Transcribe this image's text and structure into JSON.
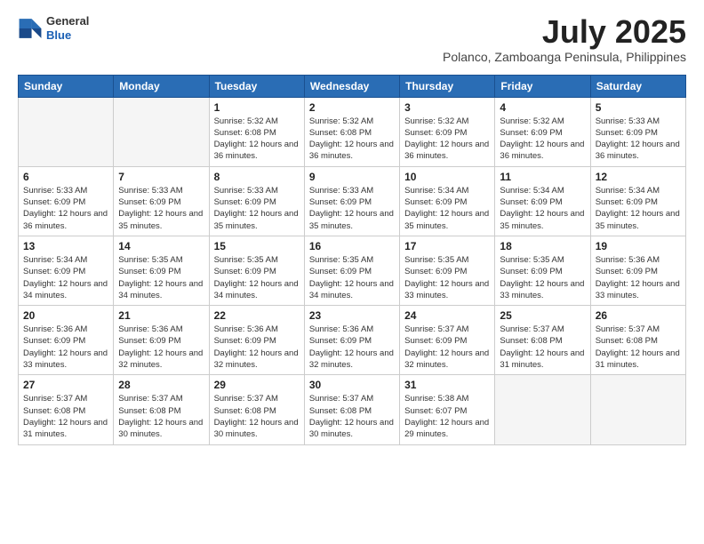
{
  "header": {
    "logo": {
      "general": "General",
      "blue": "Blue"
    },
    "title": "July 2025",
    "subtitle": "Polanco, Zamboanga Peninsula, Philippines"
  },
  "weekdays": [
    "Sunday",
    "Monday",
    "Tuesday",
    "Wednesday",
    "Thursday",
    "Friday",
    "Saturday"
  ],
  "weeks": [
    [
      {
        "day": "",
        "empty": true
      },
      {
        "day": "",
        "empty": true
      },
      {
        "day": "1",
        "sunrise": "Sunrise: 5:32 AM",
        "sunset": "Sunset: 6:08 PM",
        "daylight": "Daylight: 12 hours and 36 minutes."
      },
      {
        "day": "2",
        "sunrise": "Sunrise: 5:32 AM",
        "sunset": "Sunset: 6:08 PM",
        "daylight": "Daylight: 12 hours and 36 minutes."
      },
      {
        "day": "3",
        "sunrise": "Sunrise: 5:32 AM",
        "sunset": "Sunset: 6:09 PM",
        "daylight": "Daylight: 12 hours and 36 minutes."
      },
      {
        "day": "4",
        "sunrise": "Sunrise: 5:32 AM",
        "sunset": "Sunset: 6:09 PM",
        "daylight": "Daylight: 12 hours and 36 minutes."
      },
      {
        "day": "5",
        "sunrise": "Sunrise: 5:33 AM",
        "sunset": "Sunset: 6:09 PM",
        "daylight": "Daylight: 12 hours and 36 minutes."
      }
    ],
    [
      {
        "day": "6",
        "sunrise": "Sunrise: 5:33 AM",
        "sunset": "Sunset: 6:09 PM",
        "daylight": "Daylight: 12 hours and 36 minutes."
      },
      {
        "day": "7",
        "sunrise": "Sunrise: 5:33 AM",
        "sunset": "Sunset: 6:09 PM",
        "daylight": "Daylight: 12 hours and 35 minutes."
      },
      {
        "day": "8",
        "sunrise": "Sunrise: 5:33 AM",
        "sunset": "Sunset: 6:09 PM",
        "daylight": "Daylight: 12 hours and 35 minutes."
      },
      {
        "day": "9",
        "sunrise": "Sunrise: 5:33 AM",
        "sunset": "Sunset: 6:09 PM",
        "daylight": "Daylight: 12 hours and 35 minutes."
      },
      {
        "day": "10",
        "sunrise": "Sunrise: 5:34 AM",
        "sunset": "Sunset: 6:09 PM",
        "daylight": "Daylight: 12 hours and 35 minutes."
      },
      {
        "day": "11",
        "sunrise": "Sunrise: 5:34 AM",
        "sunset": "Sunset: 6:09 PM",
        "daylight": "Daylight: 12 hours and 35 minutes."
      },
      {
        "day": "12",
        "sunrise": "Sunrise: 5:34 AM",
        "sunset": "Sunset: 6:09 PM",
        "daylight": "Daylight: 12 hours and 35 minutes."
      }
    ],
    [
      {
        "day": "13",
        "sunrise": "Sunrise: 5:34 AM",
        "sunset": "Sunset: 6:09 PM",
        "daylight": "Daylight: 12 hours and 34 minutes."
      },
      {
        "day": "14",
        "sunrise": "Sunrise: 5:35 AM",
        "sunset": "Sunset: 6:09 PM",
        "daylight": "Daylight: 12 hours and 34 minutes."
      },
      {
        "day": "15",
        "sunrise": "Sunrise: 5:35 AM",
        "sunset": "Sunset: 6:09 PM",
        "daylight": "Daylight: 12 hours and 34 minutes."
      },
      {
        "day": "16",
        "sunrise": "Sunrise: 5:35 AM",
        "sunset": "Sunset: 6:09 PM",
        "daylight": "Daylight: 12 hours and 34 minutes."
      },
      {
        "day": "17",
        "sunrise": "Sunrise: 5:35 AM",
        "sunset": "Sunset: 6:09 PM",
        "daylight": "Daylight: 12 hours and 33 minutes."
      },
      {
        "day": "18",
        "sunrise": "Sunrise: 5:35 AM",
        "sunset": "Sunset: 6:09 PM",
        "daylight": "Daylight: 12 hours and 33 minutes."
      },
      {
        "day": "19",
        "sunrise": "Sunrise: 5:36 AM",
        "sunset": "Sunset: 6:09 PM",
        "daylight": "Daylight: 12 hours and 33 minutes."
      }
    ],
    [
      {
        "day": "20",
        "sunrise": "Sunrise: 5:36 AM",
        "sunset": "Sunset: 6:09 PM",
        "daylight": "Daylight: 12 hours and 33 minutes."
      },
      {
        "day": "21",
        "sunrise": "Sunrise: 5:36 AM",
        "sunset": "Sunset: 6:09 PM",
        "daylight": "Daylight: 12 hours and 32 minutes."
      },
      {
        "day": "22",
        "sunrise": "Sunrise: 5:36 AM",
        "sunset": "Sunset: 6:09 PM",
        "daylight": "Daylight: 12 hours and 32 minutes."
      },
      {
        "day": "23",
        "sunrise": "Sunrise: 5:36 AM",
        "sunset": "Sunset: 6:09 PM",
        "daylight": "Daylight: 12 hours and 32 minutes."
      },
      {
        "day": "24",
        "sunrise": "Sunrise: 5:37 AM",
        "sunset": "Sunset: 6:09 PM",
        "daylight": "Daylight: 12 hours and 32 minutes."
      },
      {
        "day": "25",
        "sunrise": "Sunrise: 5:37 AM",
        "sunset": "Sunset: 6:08 PM",
        "daylight": "Daylight: 12 hours and 31 minutes."
      },
      {
        "day": "26",
        "sunrise": "Sunrise: 5:37 AM",
        "sunset": "Sunset: 6:08 PM",
        "daylight": "Daylight: 12 hours and 31 minutes."
      }
    ],
    [
      {
        "day": "27",
        "sunrise": "Sunrise: 5:37 AM",
        "sunset": "Sunset: 6:08 PM",
        "daylight": "Daylight: 12 hours and 31 minutes."
      },
      {
        "day": "28",
        "sunrise": "Sunrise: 5:37 AM",
        "sunset": "Sunset: 6:08 PM",
        "daylight": "Daylight: 12 hours and 30 minutes."
      },
      {
        "day": "29",
        "sunrise": "Sunrise: 5:37 AM",
        "sunset": "Sunset: 6:08 PM",
        "daylight": "Daylight: 12 hours and 30 minutes."
      },
      {
        "day": "30",
        "sunrise": "Sunrise: 5:37 AM",
        "sunset": "Sunset: 6:08 PM",
        "daylight": "Daylight: 12 hours and 30 minutes."
      },
      {
        "day": "31",
        "sunrise": "Sunrise: 5:38 AM",
        "sunset": "Sunset: 6:07 PM",
        "daylight": "Daylight: 12 hours and 29 minutes."
      },
      {
        "day": "",
        "empty": true
      },
      {
        "day": "",
        "empty": true
      }
    ]
  ]
}
